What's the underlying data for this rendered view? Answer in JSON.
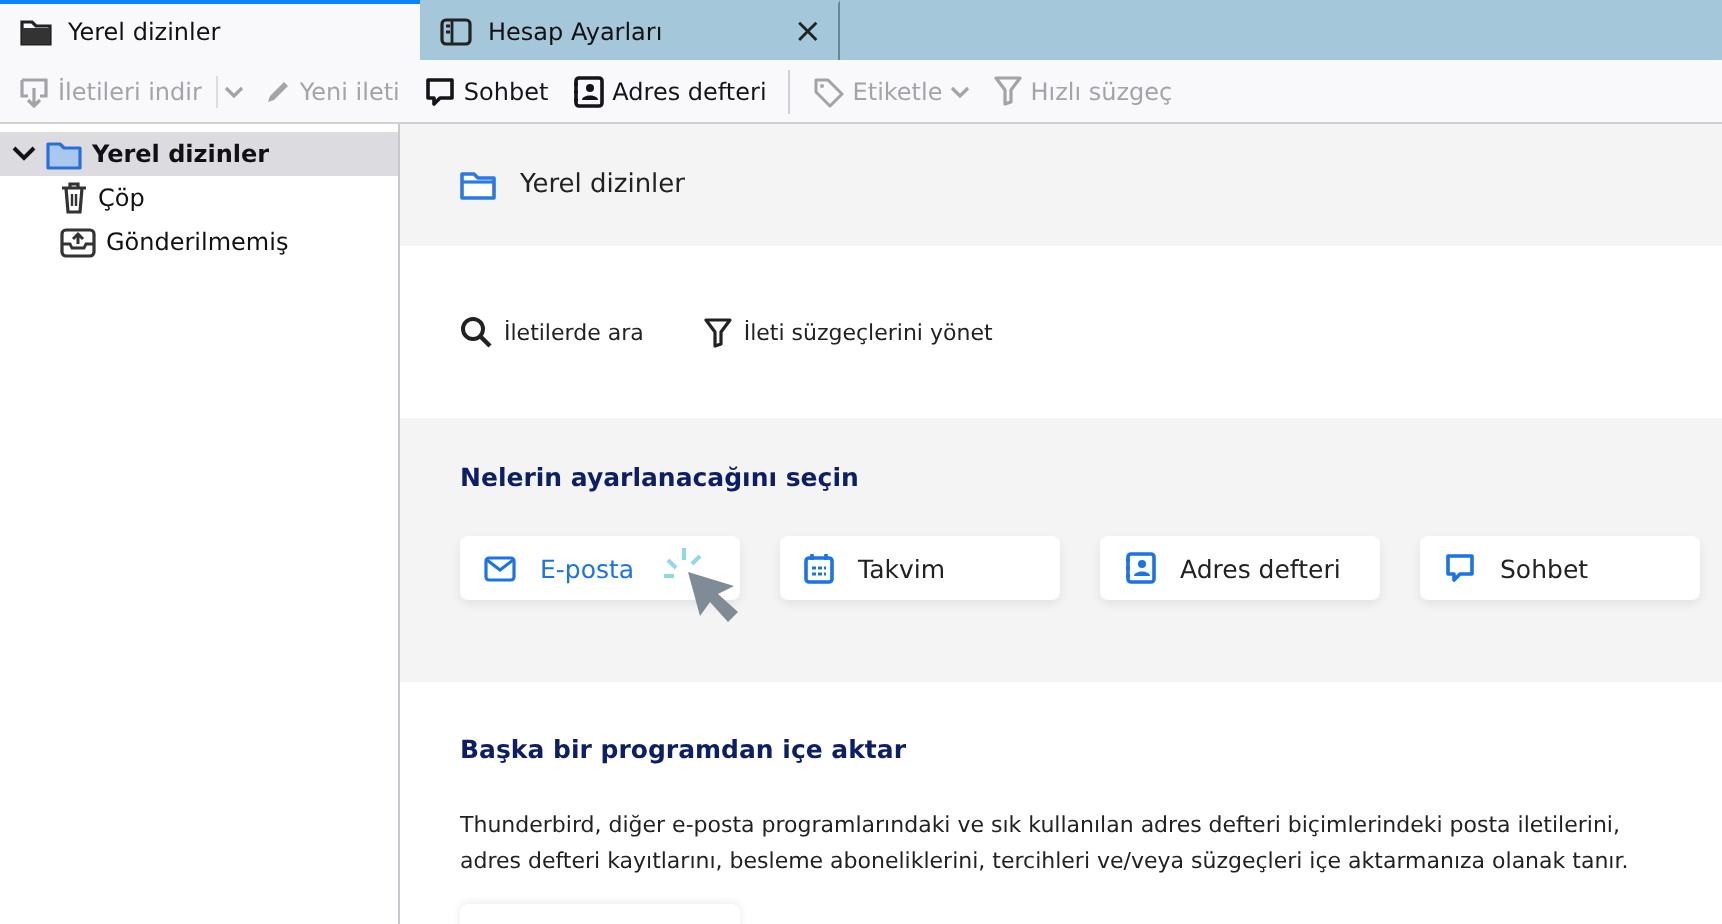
{
  "tabs": [
    {
      "label": "Yerel dizinler",
      "selected": true,
      "closable": false
    },
    {
      "label": "Hesap Ayarları",
      "selected": false,
      "closable": true
    }
  ],
  "close_glyph": "×",
  "toolbar": [
    {
      "kind": "button",
      "label": "İletileri indir",
      "disabled": true
    },
    {
      "kind": "dropdown",
      "disabled": true
    },
    {
      "kind": "button",
      "label": "Yeni ileti",
      "disabled": true
    },
    {
      "kind": "button",
      "label": "Sohbet",
      "disabled": false
    },
    {
      "kind": "button",
      "label": "Adres defteri",
      "disabled": false
    },
    {
      "kind": "separator"
    },
    {
      "kind": "menu",
      "label": "Etiketle",
      "disabled": true
    },
    {
      "kind": "button",
      "label": "Hızlı süzgeç",
      "disabled": true
    }
  ],
  "folders": [
    {
      "name": "Yerel dizinler",
      "selected": true,
      "expanded": true,
      "children": [
        {
          "name": "Çöp",
          "selected": false
        },
        {
          "name": "Gönderilmemiş",
          "selected": false
        }
      ]
    }
  ],
  "account": {
    "title": "Yerel dizinler",
    "actions": [
      "İletilerde ara",
      "İleti süzgeçlerini yönet"
    ],
    "setup_heading": "Nelerin ayarlanacağını seçin",
    "setup_cards": [
      {
        "label": "E-posta",
        "hovered": true
      },
      {
        "label": "Takvim",
        "hovered": false
      },
      {
        "label": "Adres defteri",
        "hovered": false
      },
      {
        "label": "Sohbet",
        "hovered": false
      }
    ],
    "import_heading": "Başka bir programdan içe aktar",
    "import_text": "Thunderbird, diğer e-posta programlarındaki ve sık kullanılan adres defteri biçimlerindeki posta iletilerini, adres defteri kayıtlarını, besleme aboneliklerini, tercihleri ve/veya süzgeçleri içe aktarmanıza olanak tanır."
  }
}
